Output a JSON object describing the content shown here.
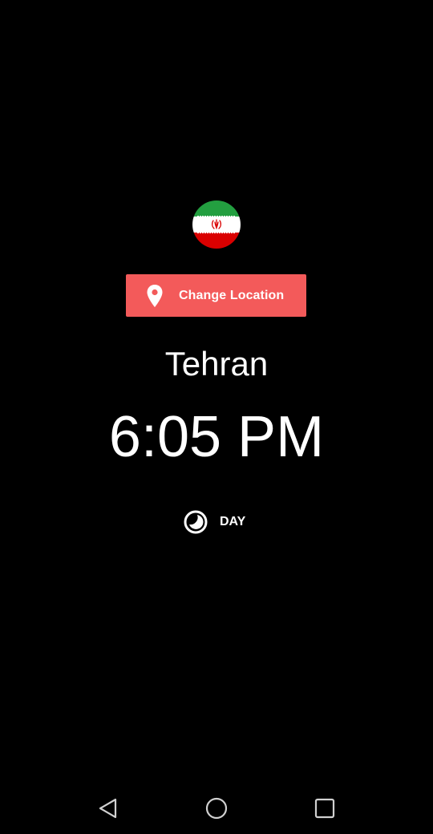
{
  "location": {
    "flag_icon": "iran-flag-icon",
    "change_button_label": "Change Location",
    "change_button_icon": "location-pin-icon",
    "city": "Tehran"
  },
  "clock": {
    "time": "6:05 PM"
  },
  "period": {
    "icon": "day-night-icon",
    "label": "DAY"
  },
  "navigation": {
    "back_icon": "back-triangle-icon",
    "home_icon": "home-circle-icon",
    "recents_icon": "recents-square-icon"
  },
  "colors": {
    "background": "#000000",
    "button": "#f35a5a",
    "text": "#ffffff",
    "flag_green": "#239f40",
    "flag_white": "#ffffff",
    "flag_red": "#da0000"
  }
}
